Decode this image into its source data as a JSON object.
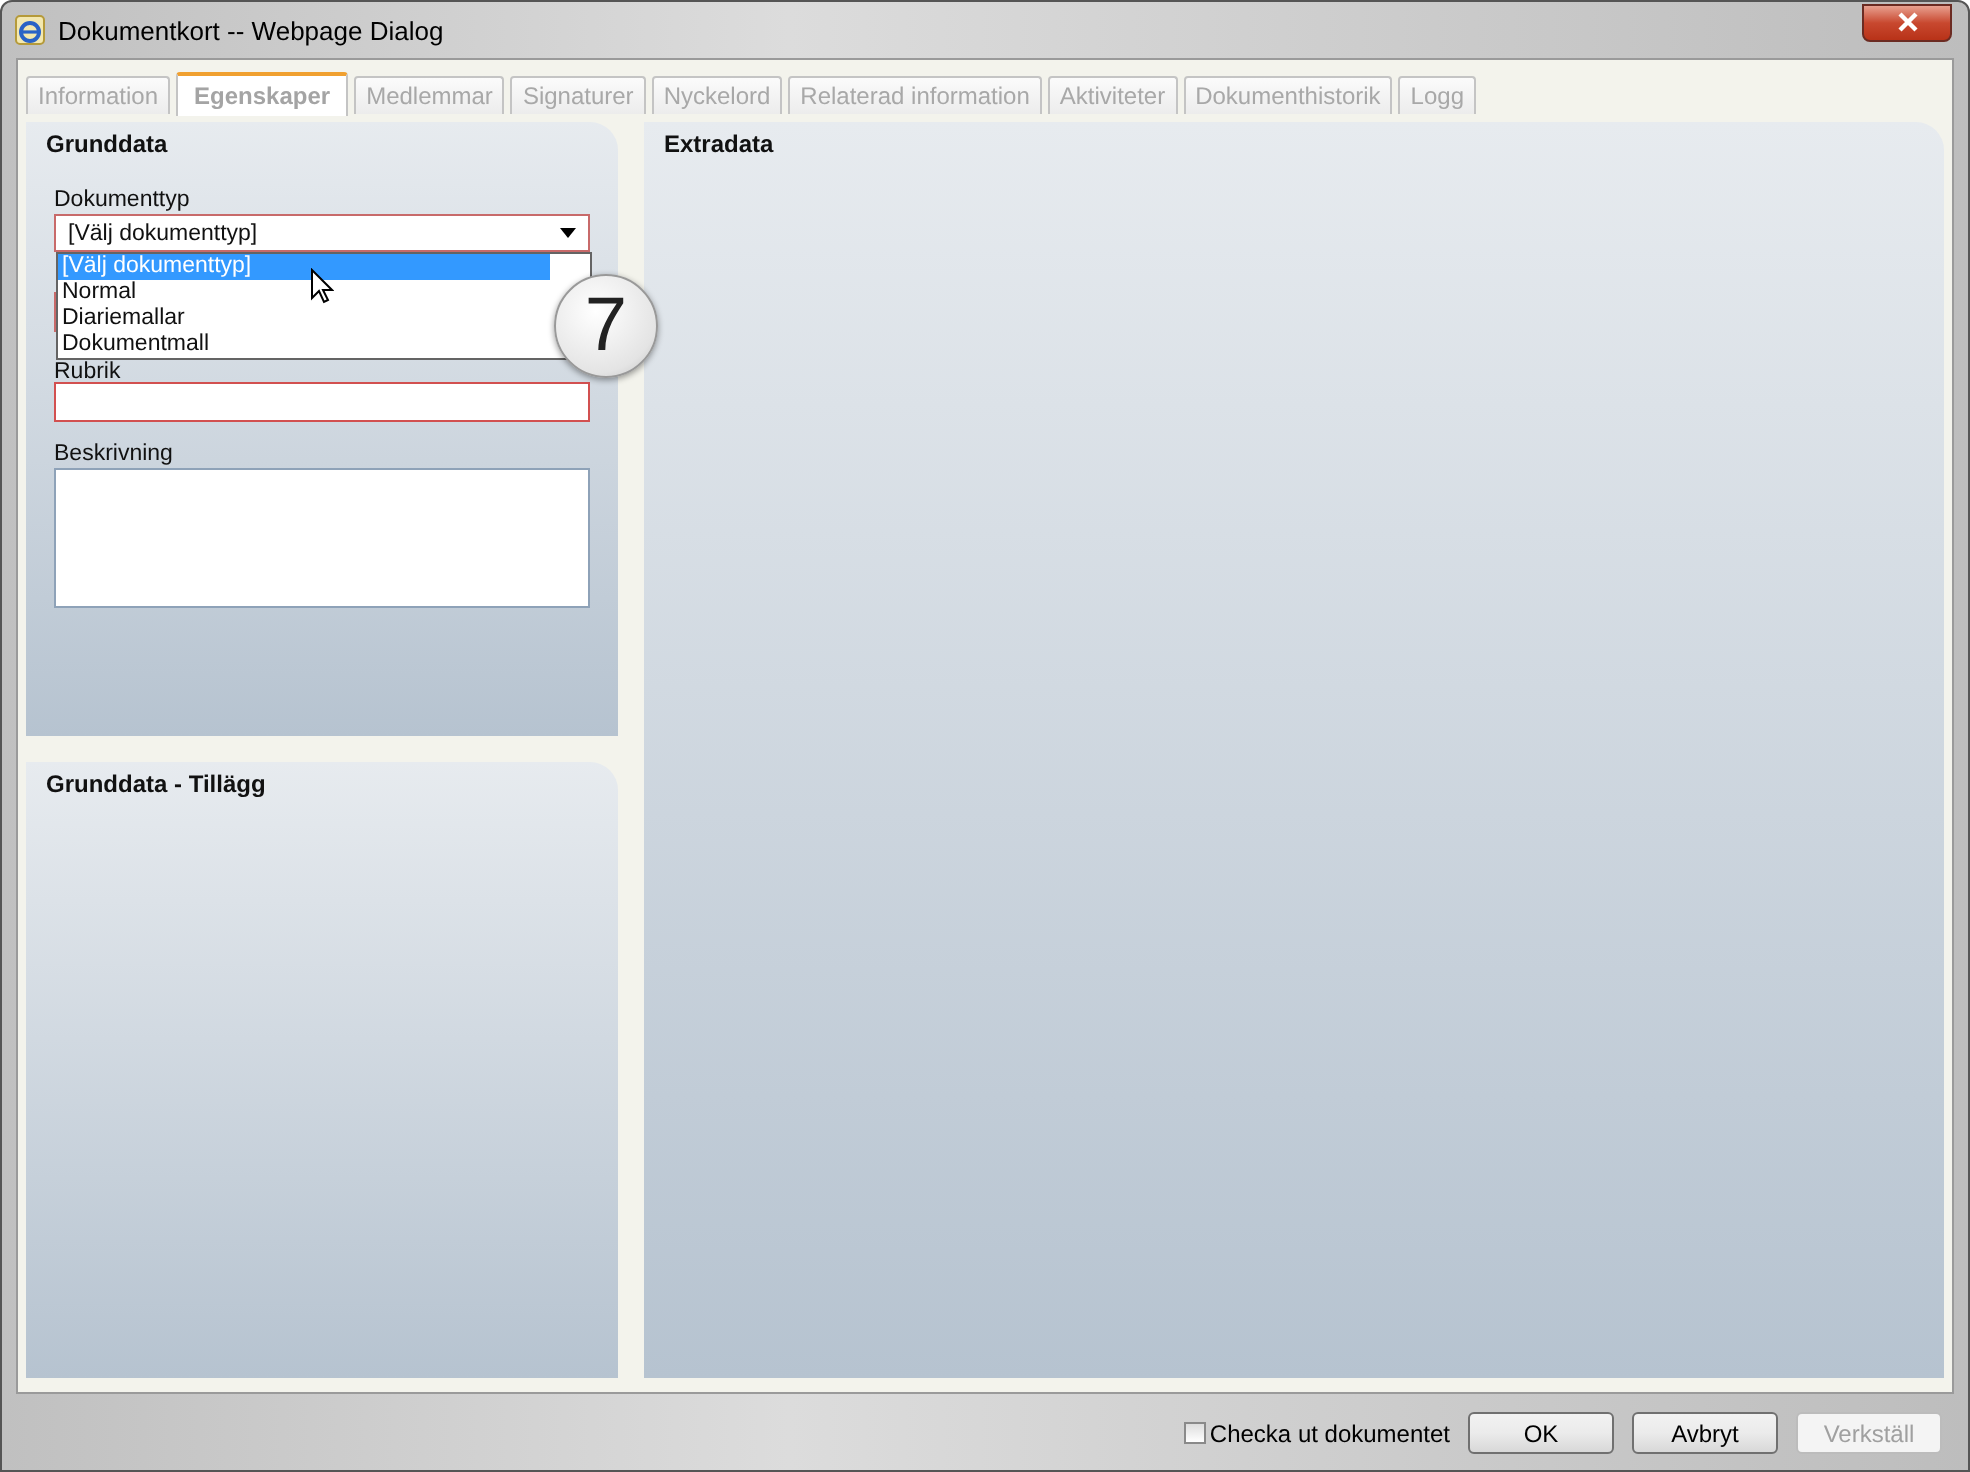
{
  "window": {
    "title": "Dokumentkort -- Webpage Dialog"
  },
  "tabs": [
    {
      "label": "Information",
      "selected": false
    },
    {
      "label": "Egenskaper",
      "selected": true
    },
    {
      "label": "Medlemmar",
      "selected": false
    },
    {
      "label": "Signaturer",
      "selected": false
    },
    {
      "label": "Nyckelord",
      "selected": false
    },
    {
      "label": "Relaterad information",
      "selected": false
    },
    {
      "label": "Aktiviteter",
      "selected": false
    },
    {
      "label": "Dokumenthistorik",
      "selected": false
    },
    {
      "label": "Logg",
      "selected": false
    }
  ],
  "grunddata": {
    "title": "Grunddata",
    "dokumenttyp": {
      "label": "Dokumenttyp",
      "value": "[Välj dokumenttyp]",
      "expanded": true,
      "options": [
        {
          "label": "[Välj dokumenttyp]",
          "selected": true
        },
        {
          "label": "Normal",
          "selected": false
        },
        {
          "label": "Diariemallar",
          "selected": false
        },
        {
          "label": "Dokumentmall",
          "selected": false
        }
      ]
    },
    "rubrik": {
      "label": "Rubrik"
    },
    "beskrivning": {
      "label": "Beskrivning"
    }
  },
  "tillagg": {
    "title": "Grunddata - Tillägg"
  },
  "extradata": {
    "title": "Extradata"
  },
  "callout": {
    "label": "7"
  },
  "footer": {
    "checkout": {
      "label": "Checka ut dokumentet",
      "checked": false
    },
    "buttons": [
      {
        "label": "OK",
        "disabled": false
      },
      {
        "label": "Avbryt",
        "disabled": false
      },
      {
        "label": "Verkställ",
        "disabled": true
      }
    ]
  }
}
